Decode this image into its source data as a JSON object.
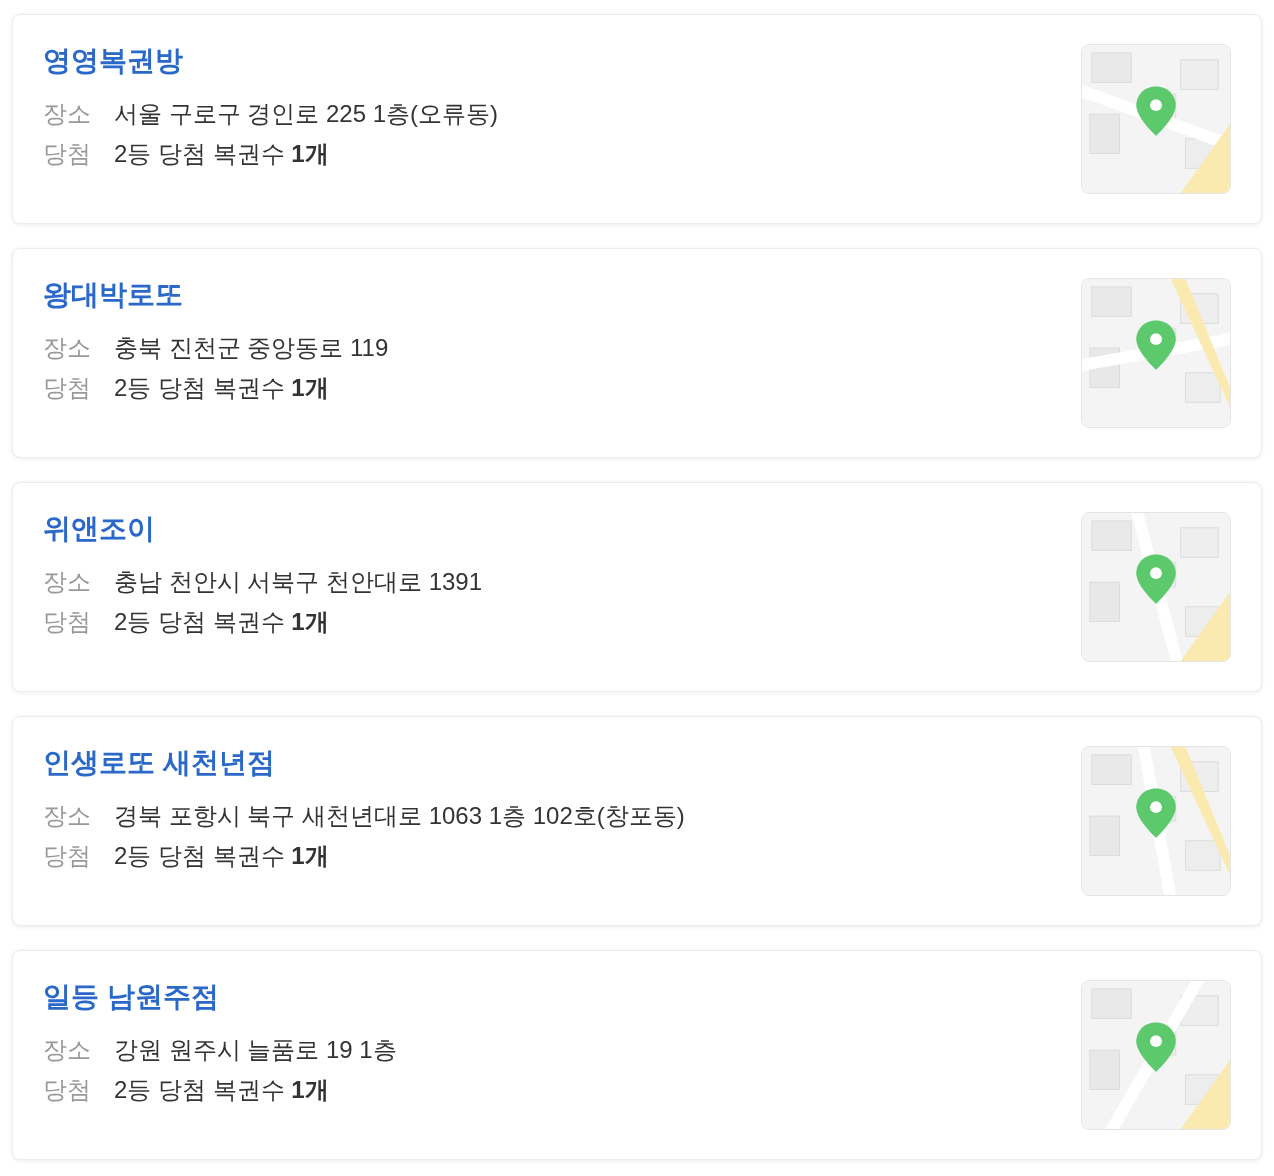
{
  "stores": [
    {
      "name": "영영복권방",
      "rows": [
        {
          "label": "장소",
          "value": "서울 구로구 경인로 225 1층(오류동)"
        },
        {
          "label": "당첨",
          "value": "2등 당첨 복권수 **1개**"
        }
      ]
    },
    {
      "name": "왕대박로또",
      "rows": [
        {
          "label": "장소",
          "value": "충북 진천군 중앙동로 119"
        },
        {
          "label": "당첨",
          "value": "2등 당첨 복권수 **1개**"
        }
      ]
    },
    {
      "name": "위앤조이",
      "rows": [
        {
          "label": "장소",
          "value": "충남 천안시 서북구 천안대로 1391"
        },
        {
          "label": "당첨",
          "value": "2등 당첨 복권수 **1개**"
        }
      ]
    },
    {
      "name": "인생로또 새천년점",
      "rows": [
        {
          "label": "장소",
          "value": "경북 포항시 북구 새천년대로 1063 1층 102호(창포동)"
        },
        {
          "label": "당첨",
          "value": "2등 당첨 복권수 **1개**"
        }
      ]
    },
    {
      "name": "일등 남원주점",
      "rows": [
        {
          "label": "장소",
          "value": "강원 원주시 늘품로 19 1층"
        },
        {
          "label": "당첨",
          "value": "2등 당첨 복권수 **1개**"
        }
      ]
    }
  ]
}
